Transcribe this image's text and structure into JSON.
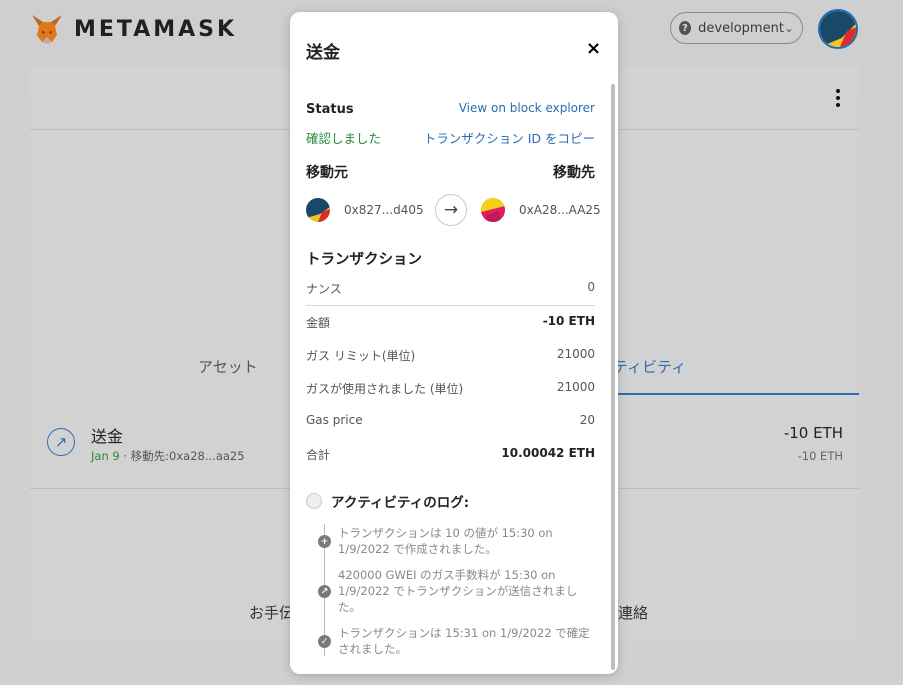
{
  "app": {
    "logo_text": "METAMASK",
    "network": "development"
  },
  "main": {
    "tabs": {
      "assets": "アセット",
      "activity": "ィティビティ"
    },
    "transaction": {
      "title": "送金",
      "date": "Jan 9",
      "separator": " · ",
      "recipient": "移動先:0xa28...aa25",
      "amount": "-10 ETH",
      "amount_secondary": "-10 ETH"
    },
    "bg_text_left": "お手伝",
    "bg_text_right": "連絡"
  },
  "modal": {
    "title": "送金",
    "close": "×",
    "status_label": "Status",
    "explorer_link": "View on block explorer",
    "status_value": "確認しました",
    "copy_tx_id": "トランザクション ID をコピー",
    "from_label": "移動元",
    "to_label": "移動先",
    "from_address": "0x827...d405",
    "to_address": "0xA28...AA25",
    "section_title": "トランザクション",
    "details": [
      {
        "label": "ナンス",
        "value": "0"
      },
      {
        "label": "金額",
        "value": "-10 ETH"
      },
      {
        "label": "ガス リミット(単位)",
        "value": "21000"
      },
      {
        "label": "ガスが使用されました (単位)",
        "value": "21000"
      },
      {
        "label": "Gas price",
        "value": "20"
      },
      {
        "label": "合計",
        "value": "10.00042 ETH"
      }
    ],
    "activity_log_title": "アクティビティのログ:",
    "activity_log": [
      {
        "icon": "plus-icon",
        "text": "トランザクションは 10 の値が 15:30 on 1/9/2022 で作成されました。"
      },
      {
        "icon": "send-arrow-icon",
        "text": "420000 GWEI のガス手数料が 15:30 on 1/9/2022 でトランザクションが送信されました。"
      },
      {
        "icon": "check-icon",
        "text": "トランザクションは 15:31 on 1/9/2022 で確定されました。"
      }
    ]
  },
  "colors": {
    "link": "#2a6db2",
    "success": "#2d8a3e",
    "fox": "#e2761b"
  }
}
